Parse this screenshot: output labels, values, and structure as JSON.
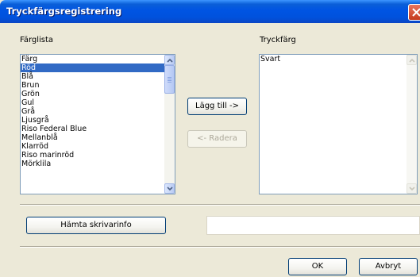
{
  "window": {
    "title": "Tryckfärgsregistrering"
  },
  "color_list": {
    "label": "Färglista",
    "items": [
      {
        "label": "Färg",
        "selected": false
      },
      {
        "label": "Röd",
        "selected": true
      },
      {
        "label": "Blå",
        "selected": false
      },
      {
        "label": "Brun",
        "selected": false
      },
      {
        "label": "Grön",
        "selected": false
      },
      {
        "label": "Gul",
        "selected": false
      },
      {
        "label": "Grå",
        "selected": false
      },
      {
        "label": "Ljusgrå",
        "selected": false
      },
      {
        "label": "Riso Federal Blue",
        "selected": false
      },
      {
        "label": "Mellanblå",
        "selected": false
      },
      {
        "label": "Klarröd",
        "selected": false
      },
      {
        "label": "Riso marinröd",
        "selected": false
      },
      {
        "label": "Mörklila",
        "selected": false
      }
    ]
  },
  "print_color": {
    "label": "Tryckfärg",
    "items": [
      {
        "label": "Svart"
      }
    ]
  },
  "buttons": {
    "add": "Lägg till ->",
    "remove": "<- Radera",
    "get_printer_info": "Hämta skrivarinfo",
    "ok": "OK",
    "cancel": "Avbryt"
  },
  "printer_info_field": {
    "value": ""
  },
  "icons": {
    "close": "close-icon",
    "scroll_up": "chevron-up-icon",
    "scroll_down": "chevron-down-icon"
  },
  "colors": {
    "title_bar": "#0054e3",
    "selection": "#316ac5",
    "dialog_bg": "#ece9d8",
    "close_button": "#c53a1d"
  }
}
